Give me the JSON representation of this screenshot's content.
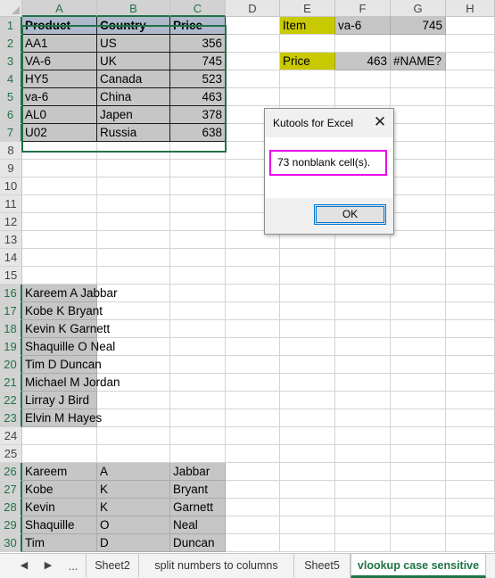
{
  "columns": [
    "A",
    "B",
    "C",
    "D",
    "E",
    "F",
    "G",
    "H"
  ],
  "rows": [
    "1",
    "2",
    "3",
    "4",
    "5",
    "6",
    "7",
    "8",
    "9",
    "10",
    "11",
    "12",
    "13",
    "14",
    "15",
    "16",
    "17",
    "18",
    "19",
    "20",
    "21",
    "22",
    "23",
    "24",
    "25",
    "26",
    "27",
    "28",
    "29",
    "30"
  ],
  "table": {
    "headers": [
      "Product",
      "Country",
      "Price"
    ],
    "rows": [
      [
        "AA1",
        "US",
        "356"
      ],
      [
        "VA-6",
        "UK",
        "745"
      ],
      [
        "HY5",
        "Canada",
        "523"
      ],
      [
        "va-6",
        "China",
        "463"
      ],
      [
        "AL0",
        "Japen",
        "378"
      ],
      [
        "U02",
        "Russia",
        "638"
      ]
    ]
  },
  "lookup": {
    "item_label": "Item",
    "item_value": "va-6",
    "item_price": "745",
    "price_label": "Price",
    "price_value": "463",
    "price_error": "#NAME?"
  },
  "names": [
    "Kareem A Jabbar",
    "Kobe K Bryant",
    "Kevin K Garnett",
    "Shaquille O Neal",
    "Tim D Duncan",
    "Michael M Jordan",
    "Lirray J Bird",
    "Elvin M Hayes"
  ],
  "split": [
    [
      "Kareem",
      "A",
      "Jabbar"
    ],
    [
      "Kobe",
      "K",
      "Bryant"
    ],
    [
      "Kevin",
      "K",
      "Garnett"
    ],
    [
      "Shaquille",
      "O",
      "Neal"
    ],
    [
      "Tim",
      "D",
      "Duncan"
    ]
  ],
  "dialog": {
    "title": "Kutools for Excel",
    "close_glyph": "✕",
    "message": "73 nonblank cell(s).",
    "ok_label": "OK"
  },
  "tabs": {
    "prev_glyph": "◀",
    "next_glyph": "▶",
    "more_label": "...",
    "items": [
      "Sheet2",
      "split numbers to columns",
      "Sheet5",
      "vlookup case sensitive"
    ],
    "active": "vlookup case sensitive"
  }
}
